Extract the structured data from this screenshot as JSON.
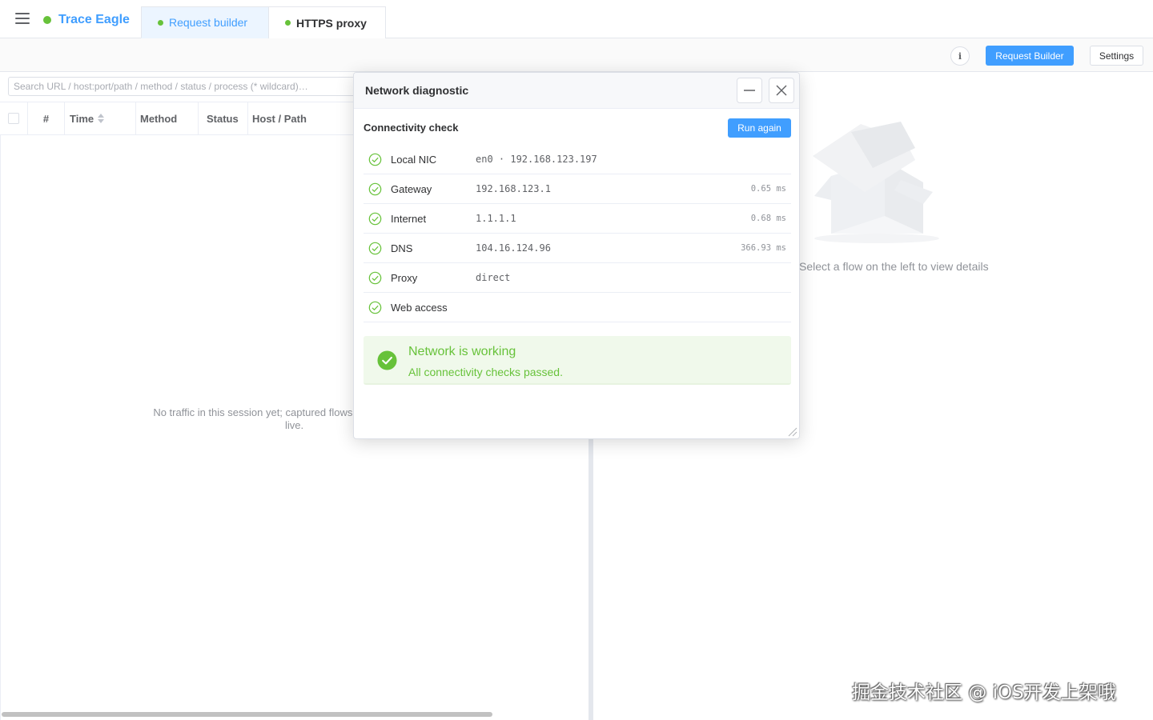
{
  "app": {
    "name": "Trace Eagle",
    "status_color": "#67c23a",
    "brand_color": "#409eff"
  },
  "tabs": [
    {
      "label": "Request builder",
      "active": true
    },
    {
      "label": "HTTPS proxy",
      "active": false
    }
  ],
  "toolbar": {
    "info_icon": "info-icon",
    "info_label": "i",
    "request_builder_label": "Request Builder",
    "settings_label": "Settings"
  },
  "search": {
    "placeholder": "Search URL / host:port/path / method / status / process (* wildcard)…"
  },
  "table": {
    "columns": [
      "#",
      "Time",
      "Method",
      "Status",
      "Host / Path"
    ],
    "empty_text": "No traffic in this session yet; captured flows will show up here live."
  },
  "detail": {
    "hint": "Select a flow on the left to view details"
  },
  "dialog": {
    "title": "Network diagnostic",
    "section_title": "Connectivity check",
    "run_again_label": "Run again",
    "checks": [
      {
        "name": "Local NIC",
        "value": "en0 · 192.168.123.197",
        "latency": "",
        "status": "ok"
      },
      {
        "name": "Gateway",
        "value": "192.168.123.1",
        "latency": "0.65 ms",
        "status": "ok"
      },
      {
        "name": "Internet",
        "value": "1.1.1.1",
        "latency": "0.68 ms",
        "status": "ok"
      },
      {
        "name": "DNS",
        "value": "104.16.124.96",
        "latency": "366.93 ms",
        "status": "ok"
      },
      {
        "name": "Proxy",
        "value": "direct",
        "latency": "",
        "status": "ok"
      },
      {
        "name": "Web access",
        "value": "",
        "latency": "",
        "status": "ok"
      }
    ],
    "result": {
      "title": "Network is working",
      "subtitle": "All connectivity checks passed."
    }
  },
  "watermark": "掘金技术社区 @ iOS开发上架哦"
}
